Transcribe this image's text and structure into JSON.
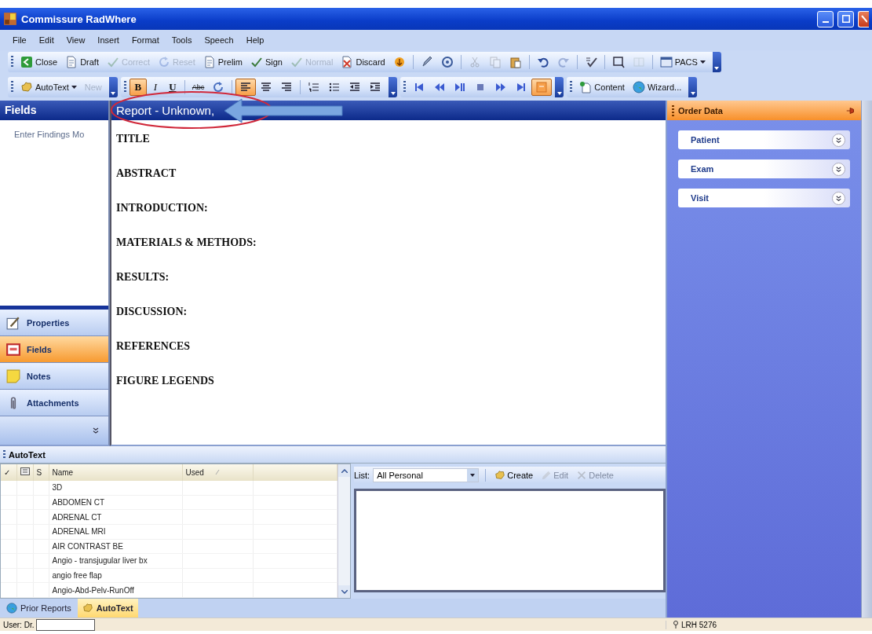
{
  "window": {
    "title": "Commissure RadWhere"
  },
  "menu": [
    "File",
    "Edit",
    "View",
    "Insert",
    "Format",
    "Tools",
    "Speech",
    "Help"
  ],
  "toolbar_main": [
    {
      "kind": "button",
      "label": "Close",
      "disabled": false
    },
    {
      "kind": "button",
      "label": "Draft",
      "disabled": false
    },
    {
      "kind": "button",
      "label": "Correct",
      "disabled": true
    },
    {
      "kind": "button",
      "label": "Reset",
      "disabled": true
    },
    {
      "kind": "button",
      "label": "Prelim",
      "disabled": false
    },
    {
      "kind": "button",
      "label": "Sign",
      "disabled": false
    },
    {
      "kind": "button",
      "label": "Normal",
      "disabled": true
    },
    {
      "kind": "button",
      "label": "Discard",
      "disabled": false
    },
    {
      "kind": "icon",
      "disabled": false
    },
    {
      "kind": "separator"
    },
    {
      "kind": "icon",
      "disabled": false
    },
    {
      "kind": "icon",
      "disabled": false
    },
    {
      "kind": "separator"
    },
    {
      "kind": "icon",
      "disabled": true
    },
    {
      "kind": "icon",
      "disabled": true
    },
    {
      "kind": "icon",
      "disabled": false
    },
    {
      "kind": "separator"
    },
    {
      "kind": "icon",
      "disabled": false
    },
    {
      "kind": "icon",
      "disabled": true
    },
    {
      "kind": "separator"
    },
    {
      "kind": "icon",
      "disabled": false
    },
    {
      "kind": "separator"
    },
    {
      "kind": "icon",
      "disabled": false
    },
    {
      "kind": "icon",
      "disabled": true
    },
    {
      "kind": "separator"
    },
    {
      "kind": "dropdown",
      "label": "PACS",
      "disabled": false
    }
  ],
  "toolbar_format": [
    {
      "kind": "dropdown",
      "label": "AutoText",
      "disabled": false
    },
    {
      "kind": "button",
      "label": "New",
      "disabled": true
    },
    {
      "kind": "break"
    },
    {
      "kind": "format",
      "label": "B",
      "selected": true
    },
    {
      "kind": "format",
      "label": "I",
      "selected": false
    },
    {
      "kind": "format",
      "label": "U",
      "selected": false
    },
    {
      "kind": "separator"
    },
    {
      "kind": "format",
      "label": "Abc",
      "selected": false
    },
    {
      "kind": "icon",
      "selected": false
    },
    {
      "kind": "separator"
    },
    {
      "kind": "icon",
      "selected": true
    },
    {
      "kind": "icon",
      "selected": false
    },
    {
      "kind": "icon",
      "selected": false
    },
    {
      "kind": "separator"
    },
    {
      "kind": "icon",
      "selected": false
    },
    {
      "kind": "icon",
      "selected": false
    },
    {
      "kind": "icon",
      "selected": false
    },
    {
      "kind": "icon",
      "selected": false
    },
    {
      "kind": "break"
    },
    {
      "kind": "icon",
      "selected": false
    },
    {
      "kind": "icon",
      "selected": false
    },
    {
      "kind": "icon",
      "selected": false
    },
    {
      "kind": "icon",
      "selected": false
    },
    {
      "kind": "icon",
      "selected": false
    },
    {
      "kind": "icon",
      "selected": false
    },
    {
      "kind": "icon",
      "selected": true
    },
    {
      "kind": "break"
    },
    {
      "kind": "button",
      "label": "Content",
      "disabled": false
    },
    {
      "kind": "button",
      "label": "Wizard...",
      "disabled": false
    }
  ],
  "fields_panel": {
    "title": "Fields",
    "text": "Enter Findings Mo",
    "nav": [
      {
        "label": "Properties",
        "selected": false
      },
      {
        "label": "Fields",
        "selected": true
      },
      {
        "label": "Notes",
        "selected": false
      },
      {
        "label": "Attachments",
        "selected": false
      }
    ]
  },
  "editor": {
    "title": "Report - Unknown,",
    "annotation": {
      "kind": "ellipse-arrow"
    },
    "sections": [
      "TITLE",
      "ABSTRACT",
      "INTRODUCTION:",
      "MATERIALS & METHODS:",
      "RESULTS:",
      "DISCUSSION:",
      "REFERENCES",
      "FIGURE LEGENDS"
    ]
  },
  "order_data": {
    "title": "Order Data",
    "groups": [
      {
        "label": "Patient",
        "expanded": false
      },
      {
        "label": "Exam",
        "expanded": false
      },
      {
        "label": "Visit",
        "expanded": false
      }
    ]
  },
  "autotext": {
    "title": "AutoText",
    "columns": [
      {
        "kind": "text",
        "label": "✓",
        "sorted": false
      },
      {
        "kind": "icon",
        "sorted": false
      },
      {
        "kind": "text",
        "label": "S",
        "sorted": false
      },
      {
        "kind": "text",
        "label": "Name",
        "sorted": false
      },
      {
        "kind": "text",
        "label": "Used",
        "sorted": true
      }
    ],
    "rows": [
      "3D",
      "ABDOMEN CT",
      "ADRENAL CT",
      "ADRENAL MRI",
      "AIR CONTRAST BE",
      "Angio - transjugular liver bx",
      "angio free flap",
      "Angio-Abd-Pelv-RunOff"
    ],
    "list": {
      "label": "List:",
      "value": "All Personal"
    },
    "actions": [
      {
        "label": "Create",
        "disabled": false
      },
      {
        "label": "Edit",
        "disabled": true
      },
      {
        "label": "Delete",
        "disabled": true
      }
    ],
    "tabs": [
      {
        "label": "Prior Reports",
        "selected": false
      },
      {
        "label": "AutoText",
        "selected": true
      }
    ]
  },
  "status_bar": {
    "user_label": "User: Dr.",
    "station": "LRH 5276"
  }
}
